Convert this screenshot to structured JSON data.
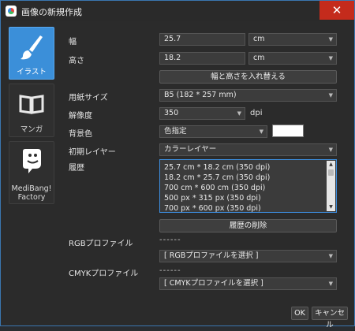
{
  "window": {
    "title": "画像の新規作成",
    "close_glyph": "✕"
  },
  "sidebar": {
    "items": [
      {
        "label": "イラスト",
        "icon": "brush-icon",
        "active": true
      },
      {
        "label": "マンガ",
        "icon": "book-icon",
        "active": false
      },
      {
        "label": "MediBang! Factory",
        "icon": "factory-icon",
        "active": false
      }
    ],
    "factory_label_line1": "MediBang!",
    "factory_label_line2": "Factory"
  },
  "form": {
    "width_label": "幅",
    "width_value": "25.7",
    "width_unit": "cm",
    "height_label": "高さ",
    "height_value": "18.2",
    "height_unit": "cm",
    "swap_button": "幅と高さを入れ替える",
    "paper_label": "用紙サイズ",
    "paper_value": "B5 (182 * 257 mm)",
    "resolution_label": "解像度",
    "resolution_value": "350",
    "resolution_unit": "dpi",
    "bg_label": "背景色",
    "bg_value": "色指定",
    "bg_color": "#ffffff",
    "layer_label": "初期レイヤー",
    "layer_value": "カラーレイヤー",
    "history_label": "履歴",
    "history_items": [
      "25.7 cm * 18.2 cm (350 dpi)",
      "18.2 cm * 25.7 cm (350 dpi)",
      "700 cm * 600 cm (350 dpi)",
      "500 px * 315 px (350 dpi)",
      "700 px * 600 px (350 dpi)"
    ],
    "clear_history_button": "履歴の削除",
    "rgb_label": "RGBプロファイル",
    "rgb_value": "------",
    "rgb_select": "[ RGBプロファイルを選択 ]",
    "cmyk_label": "CMYKプロファイル",
    "cmyk_value": "------",
    "cmyk_select": "[ CMYKプロファイルを選択 ]"
  },
  "footer": {
    "ok": "OK",
    "cancel": "キャンセル"
  },
  "colors": {
    "accent": "#3b8fd9",
    "close": "#c42b1c"
  }
}
